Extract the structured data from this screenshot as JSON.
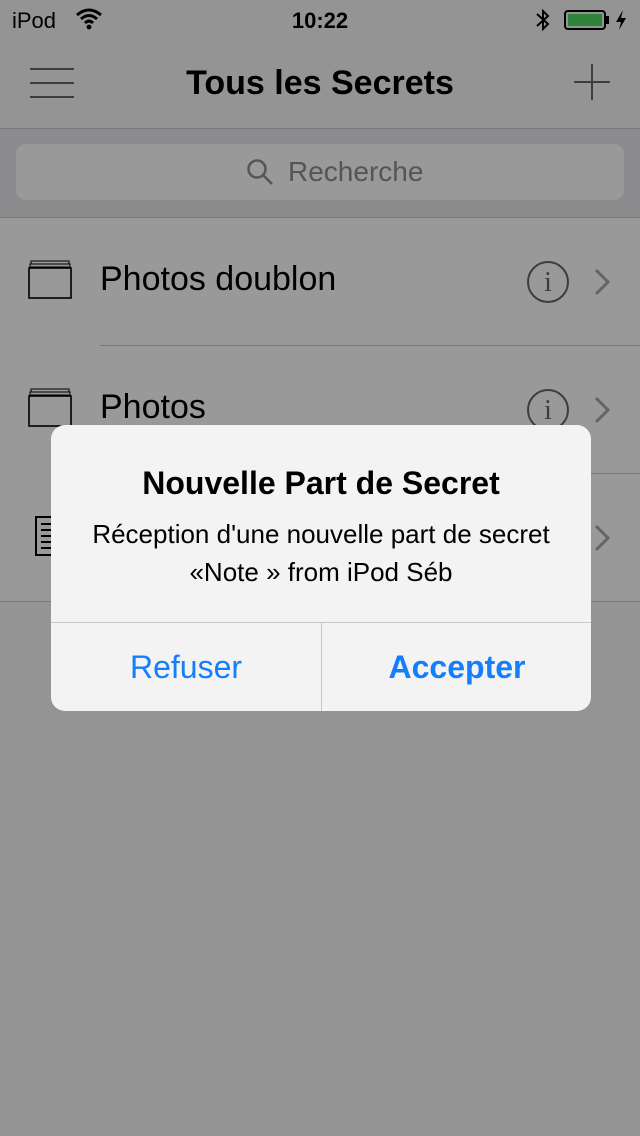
{
  "status_bar": {
    "carrier": "iPod",
    "time": "10:22",
    "wifi_icon": "wifi-icon",
    "bluetooth_icon": "bluetooth-icon",
    "battery_icon": "battery-icon",
    "charging_icon": "charging-bolt-icon",
    "battery_color": "#4cd964"
  },
  "nav": {
    "menu_icon": "hamburger-menu-icon",
    "title": "Tous les Secrets",
    "add_icon": "plus-icon"
  },
  "search": {
    "placeholder": "Recherche",
    "icon": "search-icon"
  },
  "list": {
    "items": [
      {
        "label": "Photos doublon",
        "icon": "folder-stack-icon"
      },
      {
        "label": "Photos",
        "icon": "folder-stack-icon"
      },
      {
        "label": "",
        "icon": "note-document-icon"
      }
    ],
    "info_icon": "info-icon",
    "chevron_icon": "chevron-right-icon"
  },
  "alert": {
    "title": "Nouvelle Part de Secret",
    "message": "Réception d'une nouvelle part de secret «Note » from iPod Séb",
    "cancel_label": "Refuser",
    "accept_label": "Accepter",
    "button_color": "#147efb"
  }
}
